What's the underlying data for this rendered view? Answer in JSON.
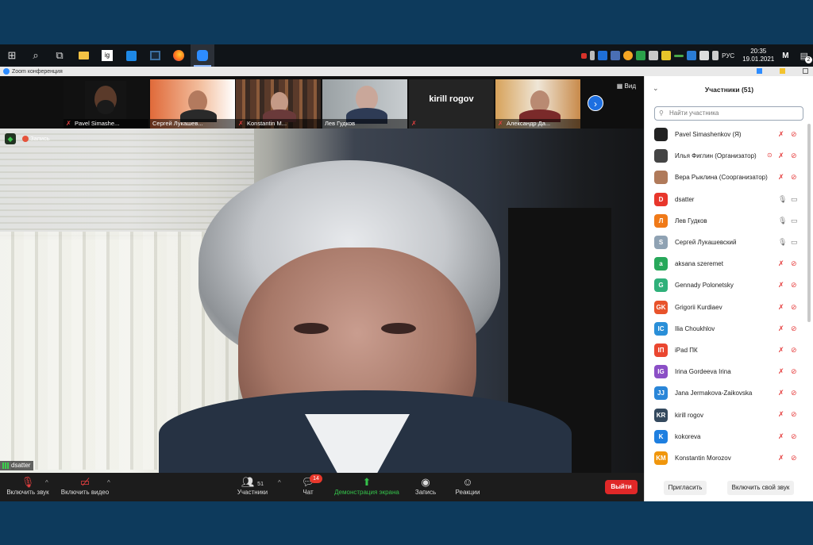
{
  "taskbar": {
    "apps": [
      "start-icon",
      "search-icon",
      "taskview-icon",
      "explorer-icon",
      "ig-app-icon",
      "word-icon",
      "tablet-icon",
      "firefox-icon",
      "zoom-icon"
    ],
    "ig_label": "ig",
    "lang": "РУС",
    "time": "20:35",
    "date": "19.01.2021",
    "notif_count": "2"
  },
  "window": {
    "title": "Zoom конференция"
  },
  "thumbnails": [
    {
      "name": "Pavel Simashe...",
      "muted": true
    },
    {
      "name": "Сергей Лукашев...",
      "muted": false
    },
    {
      "name": "Konstantin M...",
      "muted": true
    },
    {
      "name": "Лев Гудков",
      "muted": false
    },
    {
      "name": "kirill rogov",
      "muted": true
    },
    {
      "name": "Александр Да...",
      "muted": true
    }
  ],
  "view_label": "Вид",
  "recording_label": "Запись",
  "speaker_name": "dsatter",
  "toolbar": {
    "mic": "Включить звук",
    "video": "Включить видео",
    "participants": "Участники",
    "participants_count": "51",
    "chat": "Чат",
    "chat_badge": "14",
    "share": "Демонстрация экрана",
    "record": "Запись",
    "reactions": "Реакции",
    "leave": "Выйти"
  },
  "panel": {
    "title": "Участники (51)",
    "search_placeholder": "Найти участника",
    "invite": "Пригласить",
    "unmute_me": "Включить свой звук",
    "participants": [
      {
        "initials": "",
        "name": "Pavel Simashenkov (Я)",
        "color": "#222222",
        "mic": "off",
        "cam": "off"
      },
      {
        "initials": "",
        "name": "Илья Фиглин (Организатор)",
        "color": "#444444",
        "mic": "off",
        "cam": "off",
        "host": true
      },
      {
        "initials": "",
        "name": "Вера Рыклина (Соорганизатор)",
        "color": "#b07a5a",
        "mic": "off",
        "cam": "off"
      },
      {
        "initials": "D",
        "name": "dsatter",
        "color": "#e8362b",
        "mic": "on",
        "cam": "on"
      },
      {
        "initials": "Л",
        "name": "Лев Гудков",
        "color": "#f07a18",
        "mic": "on",
        "cam": "on"
      },
      {
        "initials": "S",
        "name": "Сергей Лукашевский",
        "color": "#8fa2b3",
        "mic": "on",
        "cam": "on"
      },
      {
        "initials": "a",
        "name": "aksana szeremet",
        "color": "#27a85a",
        "mic": "off",
        "cam": "off"
      },
      {
        "initials": "G",
        "name": "Gennady Polonetsky",
        "color": "#2fb07a",
        "mic": "off",
        "cam": "off"
      },
      {
        "initials": "GK",
        "name": "Grigorii Kurdiaev",
        "color": "#e8532b",
        "mic": "off",
        "cam": "off"
      },
      {
        "initials": "IC",
        "name": "Ilia Choukhlov",
        "color": "#2a8fd8",
        "mic": "off",
        "cam": "off"
      },
      {
        "initials": "IП",
        "name": "iPad ПК",
        "color": "#ea4730",
        "mic": "off",
        "cam": "off"
      },
      {
        "initials": "IG",
        "name": "Irina Gordeeva Irina",
        "color": "#8b4fc6",
        "mic": "off",
        "cam": "off"
      },
      {
        "initials": "JJ",
        "name": "Jana Jermakova-Zaikovska",
        "color": "#2a86d8",
        "mic": "off",
        "cam": "off"
      },
      {
        "initials": "KR",
        "name": "kirill rogov",
        "color": "#34495e",
        "mic": "off",
        "cam": "off"
      },
      {
        "initials": "K",
        "name": "kokoreva",
        "color": "#1e7fe0",
        "mic": "off",
        "cam": "off"
      },
      {
        "initials": "KM",
        "name": "Konstantin Morozov",
        "color": "#f0960c",
        "mic": "off",
        "cam": "off"
      }
    ]
  }
}
